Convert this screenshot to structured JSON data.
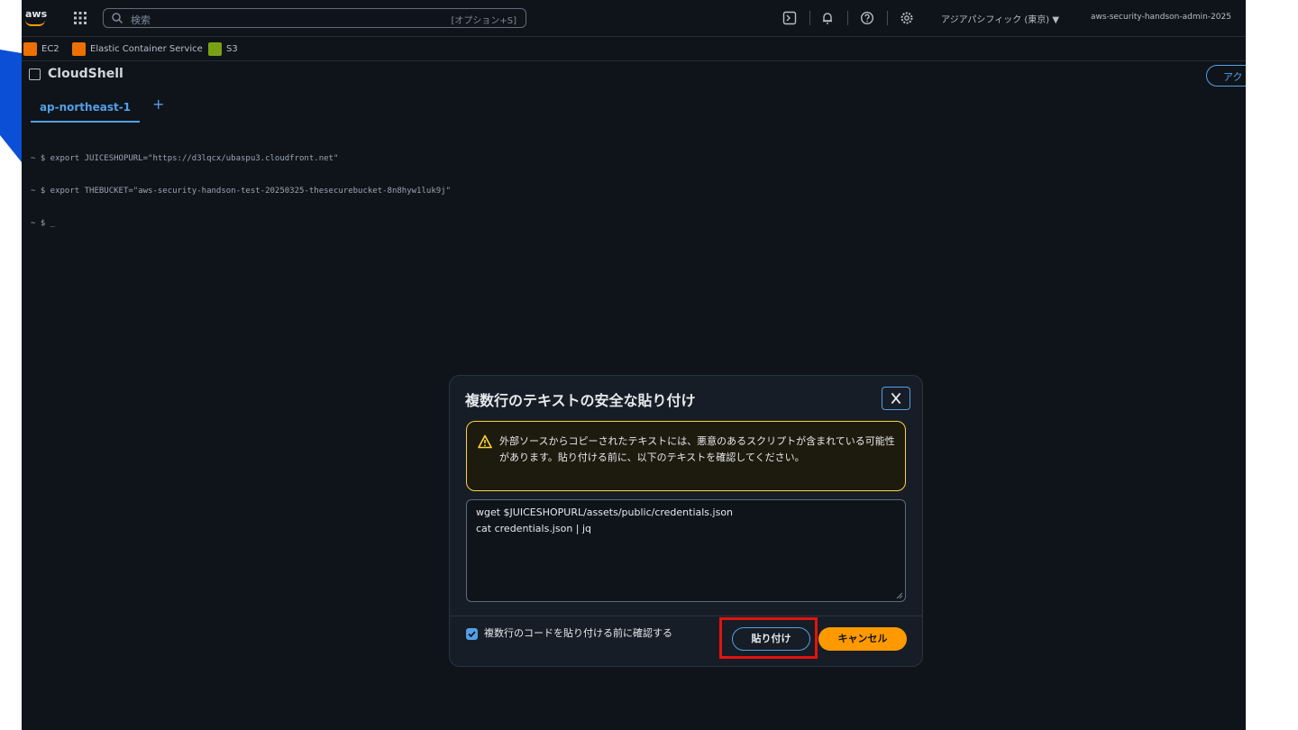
{
  "nav": {
    "logo": "aws",
    "search_placeholder": "検索",
    "search_shortcut": "[オプション+S]",
    "region": "アジアパシフィック (東京) ▼",
    "account": "aws-security-handson-admin-2025"
  },
  "favorites": [
    {
      "label": "EC2",
      "color": "#ed7100"
    },
    {
      "label": "Elastic Container Service",
      "color": "#ed7100"
    },
    {
      "label": "S3",
      "color": "#7aa116"
    }
  ],
  "cloudshell": {
    "title": "CloudShell",
    "actions_label": "アク",
    "tab_label": "ap-northeast-1",
    "tab_add": "+",
    "terminal_lines": [
      "~ $ export JUICESHOPURL=\"https://d3lqcx/ubaspu3.cloudfront.net\"",
      "~ $ export THEBUCKET=\"aws-security-handson-test-20250325-thesecurebucket-8n8hyw1luk9j\"",
      "~ $ _"
    ]
  },
  "dialog": {
    "title": "複数行のテキストの安全な貼り付け",
    "warning": "外部ソースからコピーされたテキストには、悪意のあるスクリプトが含まれている可能性があります。貼り付ける前に、以下のテキストを確認してください。",
    "code_lines": [
      "wget $JUICESHOPURL/assets/public/credentials.json",
      "cat credentials.json | jq"
    ],
    "checkbox_label": "複数行のコードを貼り付ける前に確認する",
    "checkbox_checked": true,
    "paste_label": "貼り付け",
    "cancel_label": "キャンセル"
  },
  "colors": {
    "accent": "#539fe5",
    "primary_button": "#ff9900",
    "warning_border": "#ffd333",
    "highlight": "#e2140e"
  }
}
